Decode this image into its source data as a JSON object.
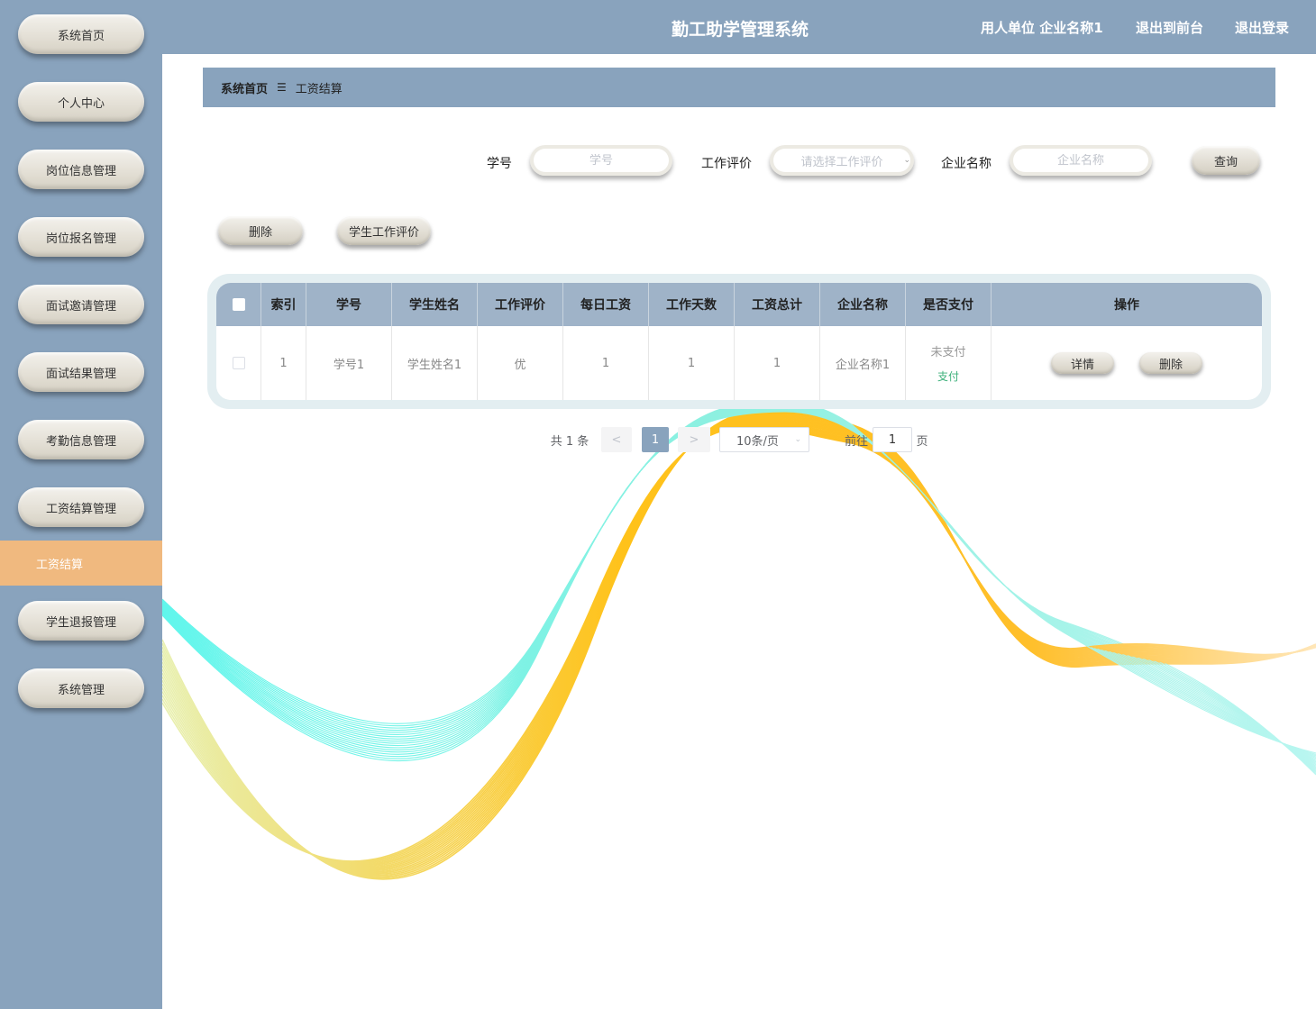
{
  "header": {
    "title": "勤工助学管理系统",
    "user_unit": "用人单位 企业名称1",
    "exit_front": "退出到前台",
    "logout": "退出登录"
  },
  "sidebar": {
    "items": [
      {
        "label": "系统首页"
      },
      {
        "label": "个人中心"
      },
      {
        "label": "岗位信息管理"
      },
      {
        "label": "岗位报名管理"
      },
      {
        "label": "面试邀请管理"
      },
      {
        "label": "面试结果管理"
      },
      {
        "label": "考勤信息管理"
      },
      {
        "label": "工资结算管理"
      },
      {
        "label": "学生退报管理"
      },
      {
        "label": "系统管理"
      }
    ],
    "active_sub": "工资结算"
  },
  "breadcrumb": {
    "home": "系统首页",
    "separator": "☰",
    "current": "工资结算"
  },
  "search": {
    "student_id_label": "学号",
    "student_id_placeholder": "学号",
    "evaluation_label": "工作评价",
    "evaluation_placeholder": "请选择工作评价",
    "company_label": "企业名称",
    "company_placeholder": "企业名称",
    "query_button": "查询"
  },
  "actions": {
    "delete_button": "删除",
    "evaluate_button": "学生工作评价"
  },
  "table": {
    "columns": [
      "索引",
      "学号",
      "学生姓名",
      "工作评价",
      "每日工资",
      "工作天数",
      "工资总计",
      "企业名称",
      "是否支付",
      "操作"
    ],
    "rows": [
      {
        "index": "1",
        "student_id": "学号1",
        "student_name": "学生姓名1",
        "evaluation": "优",
        "daily_wage": "1",
        "work_days": "1",
        "total_wage": "1",
        "company": "企业名称1",
        "paid_status": "未支付",
        "pay_link": "支付",
        "detail_button": "详情",
        "delete_button": "删除"
      }
    ]
  },
  "pagination": {
    "total": "共 1 条",
    "prev": "<",
    "current_page": "1",
    "next": ">",
    "page_size": "10条/页",
    "goto_label": "前往",
    "goto_value": "1",
    "page_suffix": "页"
  },
  "colors": {
    "sidebar_bg": "#89a3bd",
    "active_menu": "#f0b97f",
    "wave_cyan": "#3cf0e6",
    "wave_orange": "#ffb400"
  }
}
